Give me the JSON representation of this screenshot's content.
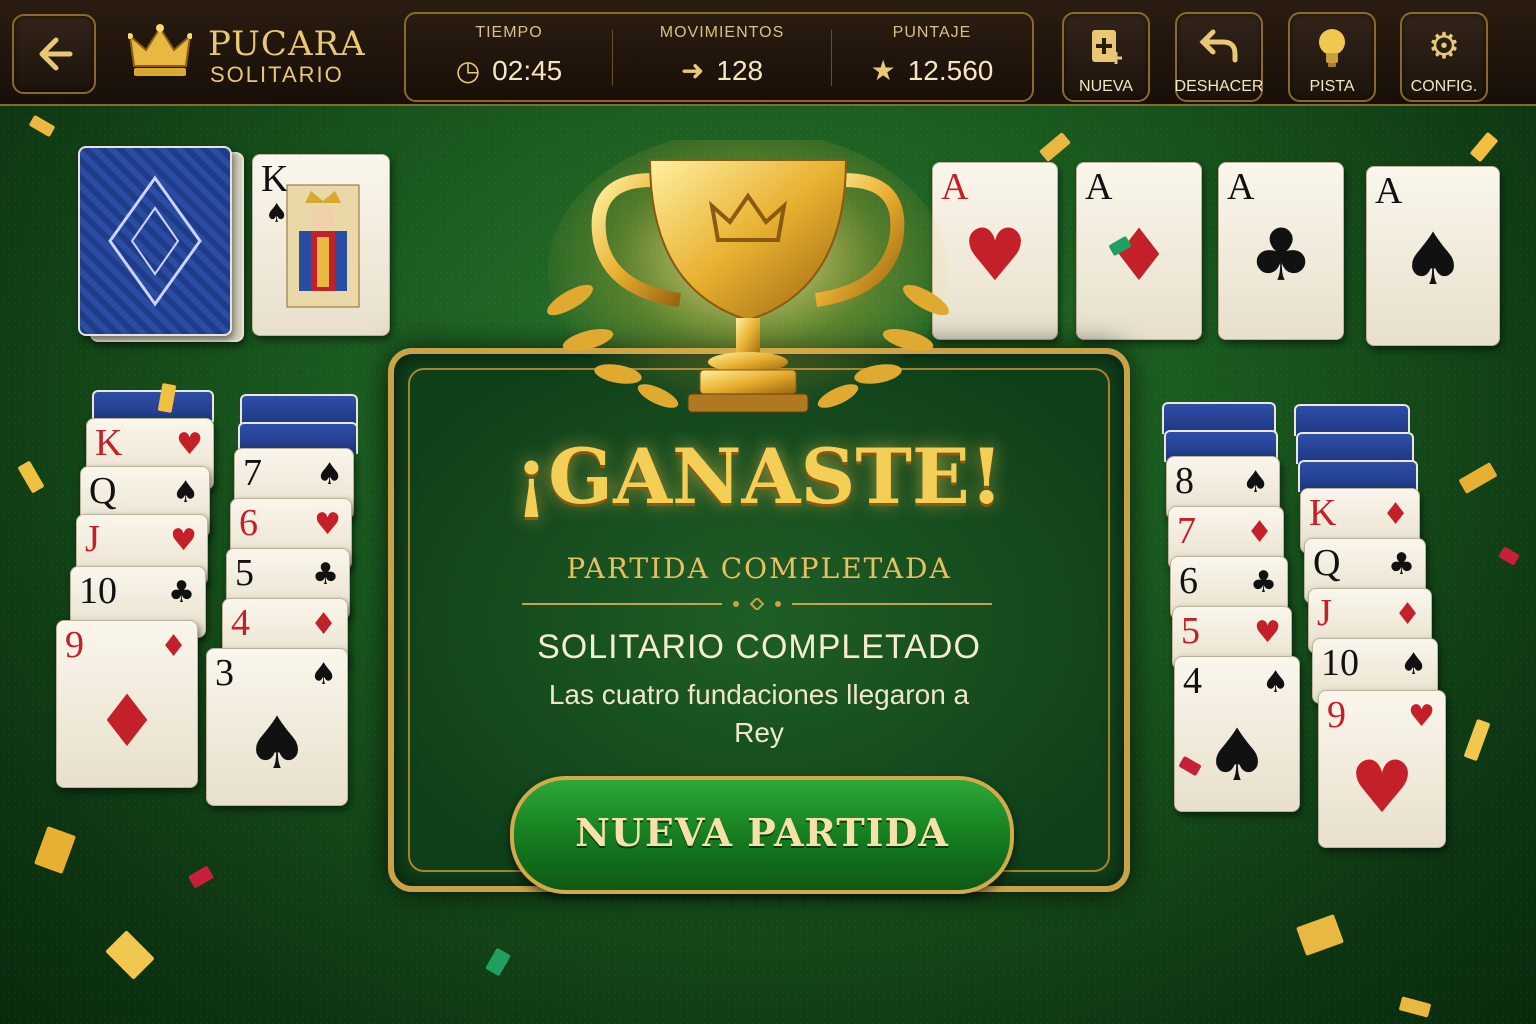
{
  "app": {
    "name": "PUCARA",
    "subtitle": "SOLITARIO"
  },
  "stats": [
    {
      "label": "TIEMPO",
      "value": "02:45",
      "icon": "clock-icon"
    },
    {
      "label": "MOVIMIENTOS",
      "value": "128",
      "icon": "arrow-right-icon"
    },
    {
      "label": "PUNTAJE",
      "value": "12.560",
      "icon": "star-icon"
    }
  ],
  "toolbar": {
    "new_label": "NUEVA",
    "undo_label": "DESHACER",
    "hint_label": "PISTA",
    "config_label": "CONFIG."
  },
  "waste_card": {
    "rank": "K",
    "suit": "♠"
  },
  "foundations": [
    {
      "rank": "A",
      "suit": "♥",
      "color": "red"
    },
    {
      "rank": "A",
      "suit": "♦",
      "color": "red"
    },
    {
      "rank": "A",
      "suit": "♣",
      "color": "black"
    },
    {
      "rank": "A",
      "suit": "♠",
      "color": "black"
    }
  ],
  "tableau": {
    "col1": [
      {
        "rank": "K",
        "suit": "♥"
      },
      {
        "rank": "Q",
        "suit": "♠"
      },
      {
        "rank": "J",
        "suit": "♥"
      },
      {
        "rank": "10",
        "suit": "♣"
      },
      {
        "rank": "9",
        "suit": "♦"
      }
    ],
    "col2": [
      {
        "rank": "7",
        "suit": "♠"
      },
      {
        "rank": "6",
        "suit": "♥"
      },
      {
        "rank": "5",
        "suit": "♣"
      },
      {
        "rank": "4",
        "suit": "♦"
      },
      {
        "rank": "3",
        "suit": "♠"
      }
    ],
    "col6": [
      {
        "rank": "8",
        "suit": "♠"
      },
      {
        "rank": "7",
        "suit": "♦"
      },
      {
        "rank": "6",
        "suit": "♣"
      },
      {
        "rank": "5",
        "suit": "♥"
      },
      {
        "rank": "4",
        "suit": "♠"
      }
    ],
    "col7": [
      {
        "rank": "K",
        "suit": "♦"
      },
      {
        "rank": "Q",
        "suit": "♣"
      },
      {
        "rank": "J",
        "suit": "♦"
      },
      {
        "rank": "10",
        "suit": "♠"
      },
      {
        "rank": "9",
        "suit": "♥"
      }
    ]
  },
  "modal": {
    "title": "¡GANASTE!",
    "subtitle": "PARTIDA COMPLETADA",
    "heading": "SOLITARIO COMPLETADO",
    "body": "Las cuatro fundaciones llegaron a Rey",
    "button": "NUEVA PARTIDA"
  },
  "colors": {
    "accent_gold": "#e8c874",
    "felt": "#1a5a1f",
    "button_green": "#147a1f"
  }
}
